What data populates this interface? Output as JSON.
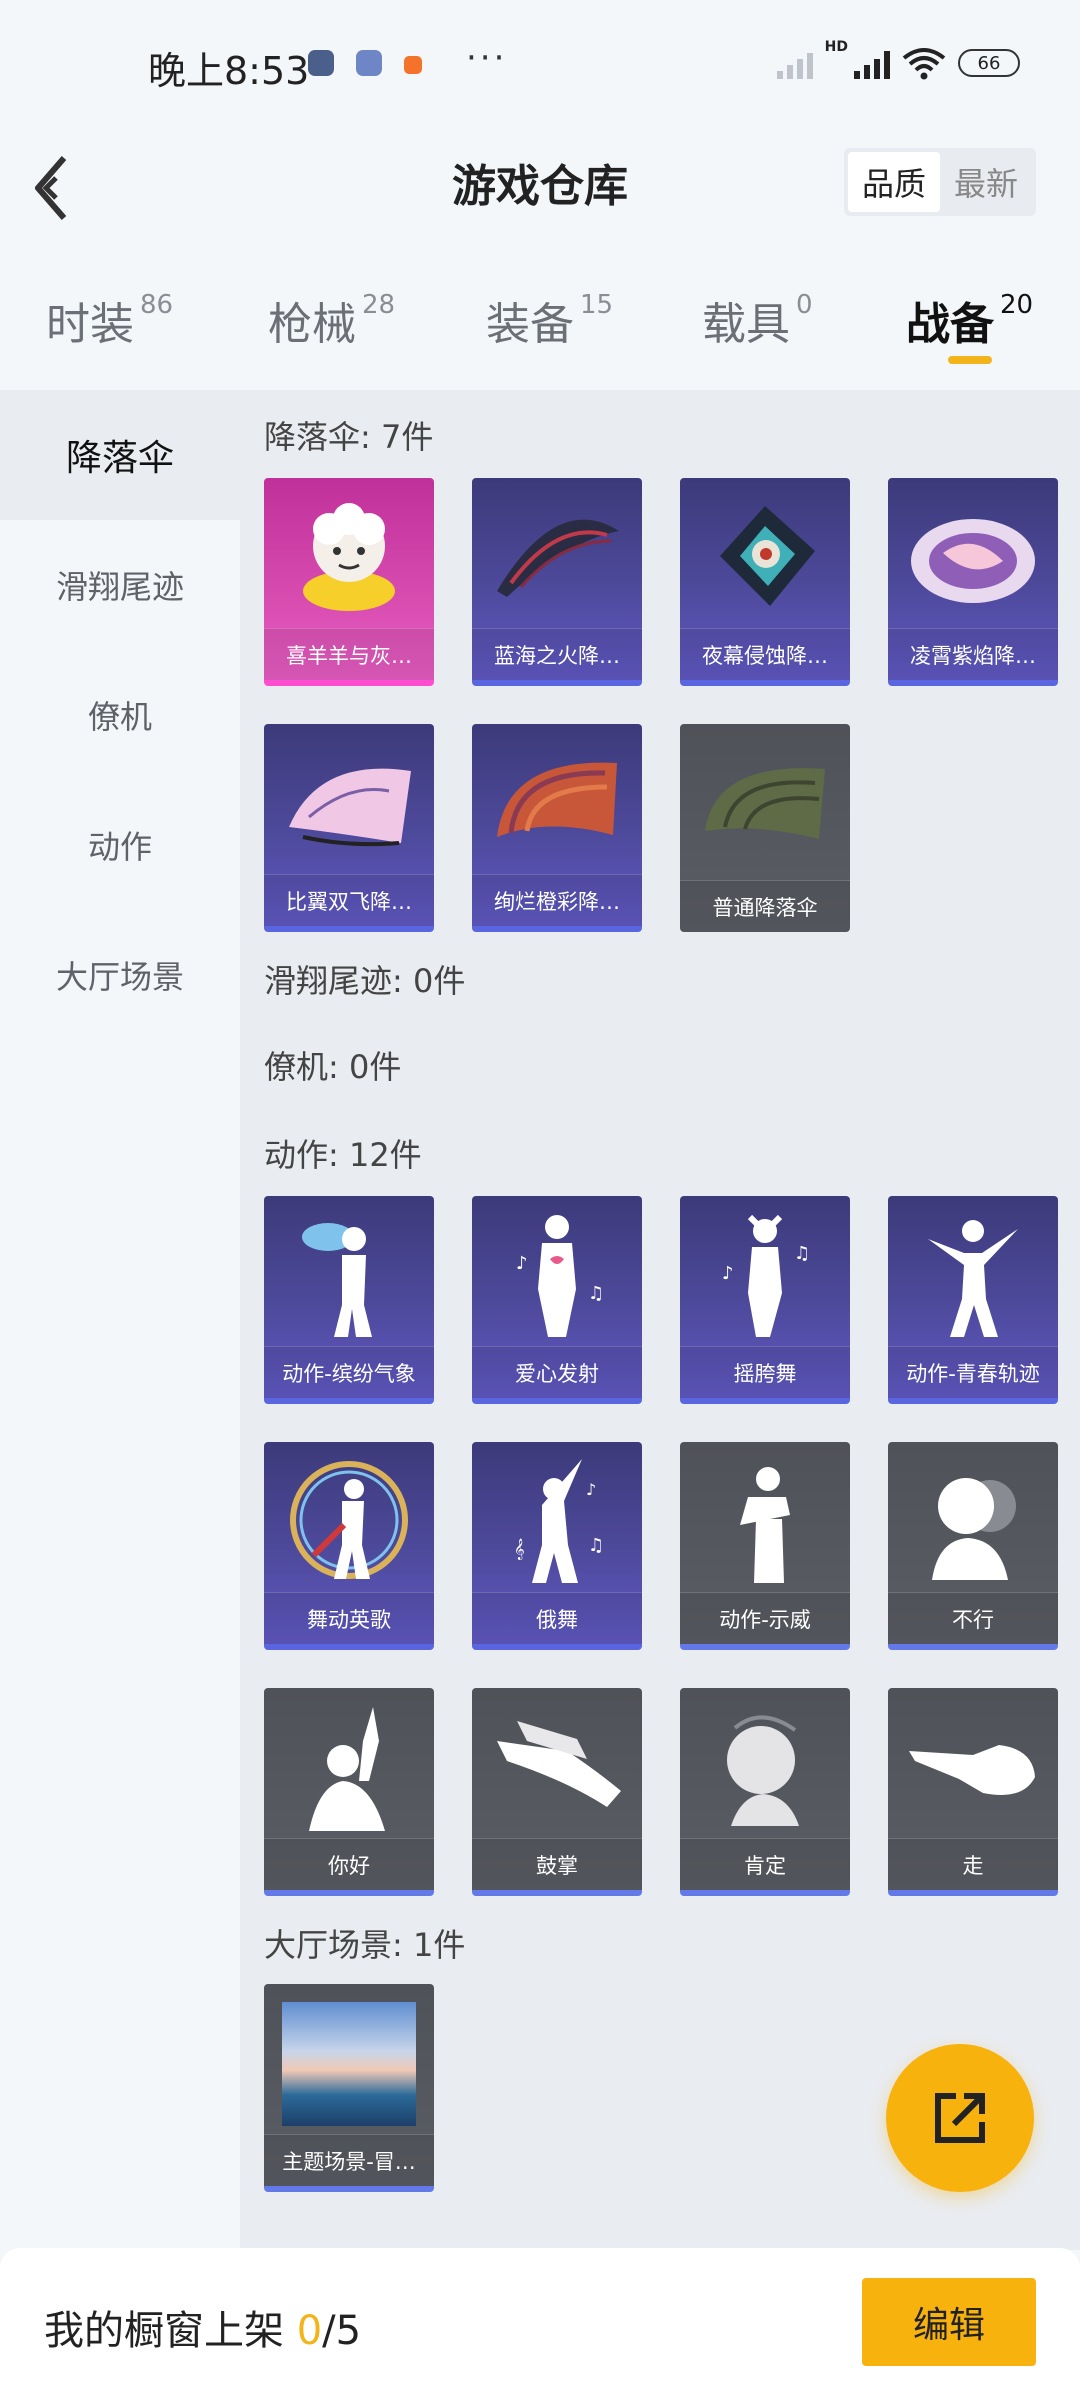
{
  "status_bar": {
    "time": "晚上8:53",
    "battery": "66",
    "hd_label": "HD",
    "more": "···"
  },
  "header": {
    "title": "游戏仓库",
    "sort_options": [
      "品质",
      "最新"
    ],
    "active_sort": "品质"
  },
  "tabs": [
    {
      "label": "时装",
      "count": "86"
    },
    {
      "label": "枪械",
      "count": "28"
    },
    {
      "label": "装备",
      "count": "15"
    },
    {
      "label": "载具",
      "count": "0"
    },
    {
      "label": "战备",
      "count": "20"
    }
  ],
  "active_tab": "战备",
  "sidebar": {
    "items": [
      "降落伞",
      "滑翔尾迹",
      "僚机",
      "动作",
      "大厅场景"
    ],
    "active": "降落伞"
  },
  "sections": {
    "parachute": {
      "title": "降落伞: 7件",
      "items": [
        "喜羊羊与灰…",
        "蓝海之火降…",
        "夜幕侵蚀降…",
        "凌霄紫焰降…",
        "比翼双飞降…",
        "绚烂橙彩降…",
        "普通降落伞"
      ]
    },
    "glide_trail": {
      "title": "滑翔尾迹: 0件"
    },
    "wingman": {
      "title": "僚机: 0件"
    },
    "emote": {
      "title": "动作: 12件",
      "items": [
        "动作-缤纷气象",
        "爱心发射",
        "摇胯舞",
        "动作-青春轨迹",
        "舞动英歌",
        "俄舞",
        "动作-示威",
        "不行",
        "你好",
        "鼓掌",
        "肯定",
        "走"
      ]
    },
    "lobby_scene": {
      "title": "大厅场景: 1件",
      "items": [
        "主题场景-冒…"
      ]
    }
  },
  "bottom_bar": {
    "label": "我的橱窗上架",
    "current": "0",
    "total": "/5",
    "edit_button": "编辑"
  },
  "colors": {
    "accent": "#f7b20e",
    "legendary": "#d84cb0",
    "epic": "#4e4a9c",
    "common": "#5a5d64"
  },
  "icons": [
    "back-arrow-icon",
    "share-export-icon",
    "wifi-icon",
    "signal-icon",
    "battery-icon"
  ]
}
